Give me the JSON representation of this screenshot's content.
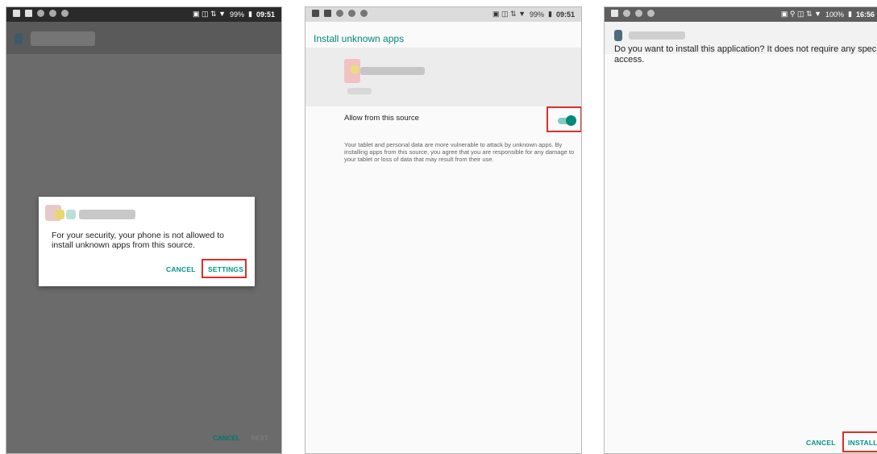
{
  "panel1": {
    "status": {
      "battery": "99%",
      "time": "09:51"
    },
    "dialog": {
      "message": "For your security, your phone is not allowed to install unknown apps from this source.",
      "cancel_label": "CANCEL",
      "settings_label": "SETTINGS"
    },
    "bottom": {
      "cancel_label": "CANCEL",
      "next_label": "NEXT"
    }
  },
  "panel2": {
    "status": {
      "battery": "99%",
      "time": "09:51"
    },
    "title": "Install unknown apps",
    "toggle_label": "Allow from this source",
    "toggle_on": true,
    "description": "Your tablet and personal data are more vulnerable to attack by unknown apps. By installing apps from this source, you agree that you are responsible for any damage to your tablet or loss of data that may result from their use."
  },
  "panel3": {
    "status": {
      "battery": "100%",
      "time": "16:56"
    },
    "message": "Do you want to install this application? It does not require any special access.",
    "cancel_label": "CANCEL",
    "install_label": "INSTALL"
  },
  "colors": {
    "accent": "#009688",
    "highlight": "#d9302b"
  }
}
